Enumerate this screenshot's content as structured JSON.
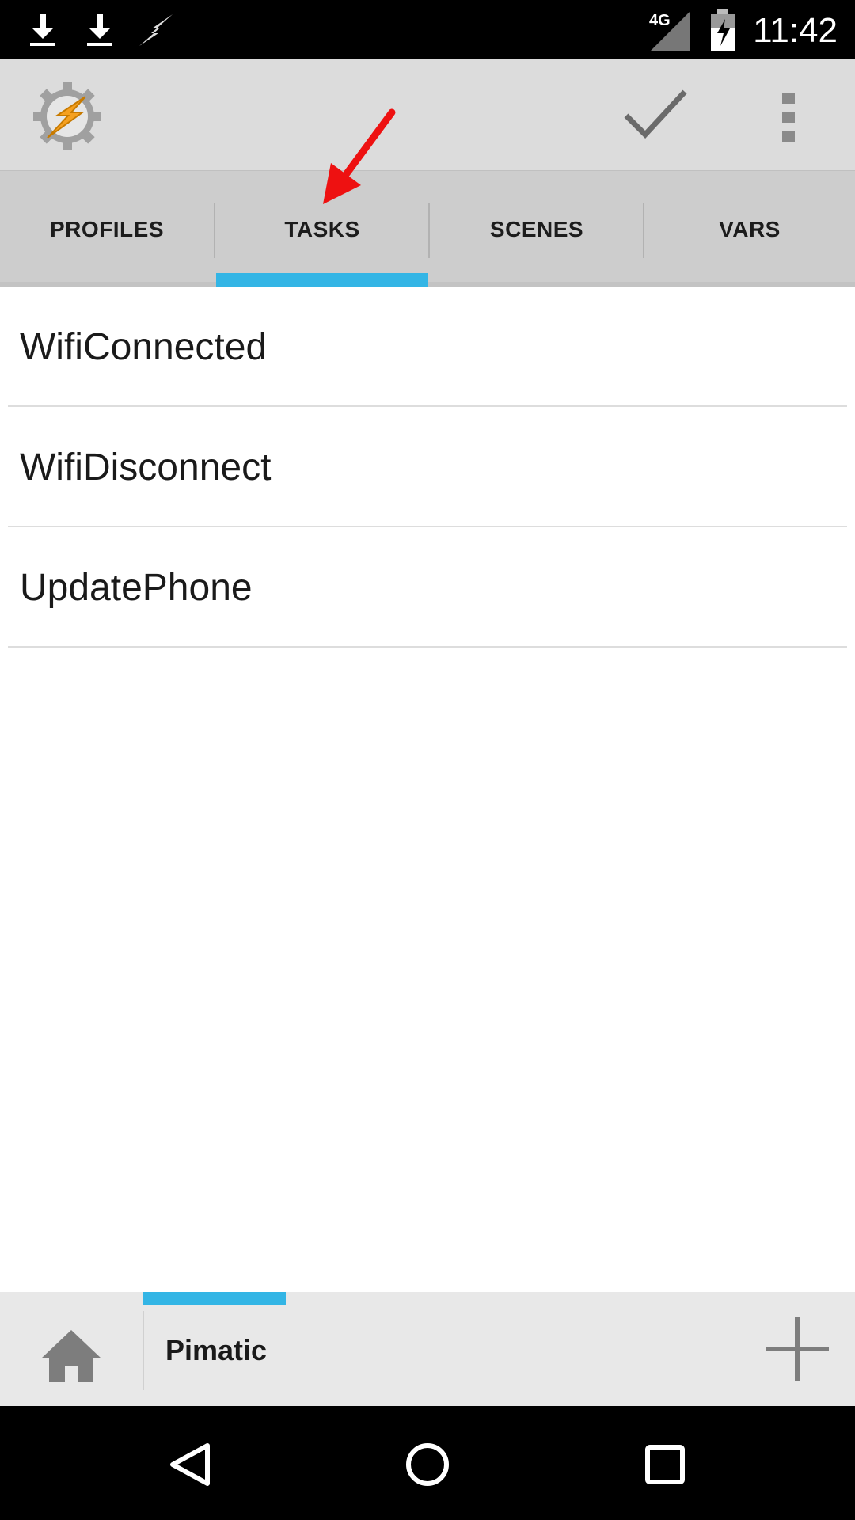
{
  "status_bar": {
    "network_label": "4G",
    "time": "11:42",
    "icons": [
      "download-icon",
      "download-icon",
      "flash-icon",
      "signal-icon",
      "battery-charging-icon"
    ]
  },
  "action_bar": {
    "app_icon": "tasker-gear-bolt-icon",
    "actions": [
      "check-icon",
      "overflow-menu-icon"
    ]
  },
  "tabs": [
    {
      "label": "PROFILES",
      "selected": false
    },
    {
      "label": "TASKS",
      "selected": true
    },
    {
      "label": "SCENES",
      "selected": false
    },
    {
      "label": "VARS",
      "selected": false
    }
  ],
  "tasks": [
    {
      "name": "WifiConnected"
    },
    {
      "name": "WifiDisconnect"
    },
    {
      "name": "UpdatePhone"
    }
  ],
  "bottom_bar": {
    "home_icon": "home-icon",
    "project_label": "Pimatic",
    "add_icon": "plus-icon"
  },
  "nav_bar": {
    "buttons": [
      "back-icon",
      "home-circle-icon",
      "recents-icon"
    ]
  },
  "colors": {
    "accent": "#33b5e5",
    "annotation_arrow": "#ee1111",
    "action_bar_bg": "#dcdcdc",
    "tab_strip_bg": "#cdcdcd"
  }
}
